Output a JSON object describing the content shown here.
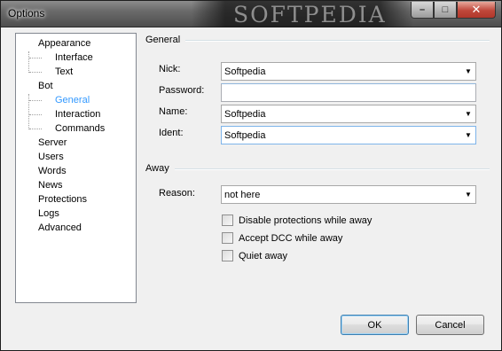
{
  "window": {
    "title": "Options",
    "watermark": "SOFTPEDIA",
    "buttons": {
      "minimize": "–",
      "maximize": "□",
      "close": "✕"
    }
  },
  "tree": {
    "items": [
      {
        "label": "Appearance"
      },
      {
        "label": "Interface"
      },
      {
        "label": "Text"
      },
      {
        "label": "Bot"
      },
      {
        "label": "General",
        "selected": true
      },
      {
        "label": "Interaction"
      },
      {
        "label": "Commands"
      },
      {
        "label": "Server"
      },
      {
        "label": "Users"
      },
      {
        "label": "Words"
      },
      {
        "label": "News"
      },
      {
        "label": "Protections"
      },
      {
        "label": "Logs"
      },
      {
        "label": "Advanced"
      }
    ]
  },
  "general": {
    "title": "General",
    "nick": {
      "label": "Nick:",
      "value": "Softpedia"
    },
    "password": {
      "label": "Password:",
      "value": ""
    },
    "name": {
      "label": "Name:",
      "value": "Softpedia"
    },
    "ident": {
      "label": "Ident:",
      "value": "Softpedia"
    }
  },
  "away": {
    "title": "Away",
    "reason": {
      "label": "Reason:",
      "value": "not here"
    },
    "checks": [
      {
        "label": "Disable protections while away",
        "checked": false
      },
      {
        "label": "Accept DCC while away",
        "checked": false
      },
      {
        "label": "Quiet away",
        "checked": false
      }
    ]
  },
  "footer": {
    "ok_label": "OK",
    "cancel_label": "Cancel"
  },
  "icons": {
    "dropdown": "chevron-down-icon"
  }
}
